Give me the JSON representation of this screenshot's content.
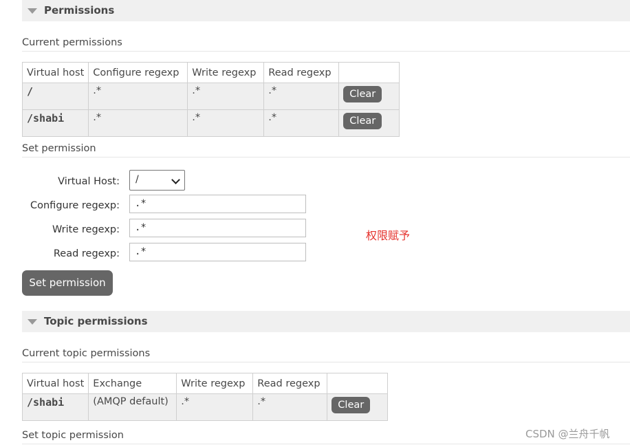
{
  "permissions_section": {
    "title": "Permissions",
    "current_title": "Current permissions",
    "table": {
      "headers": [
        "Virtual host",
        "Configure regexp",
        "Write regexp",
        "Read regexp"
      ],
      "rows": [
        {
          "vhost": "/",
          "configure": ".*",
          "write": ".*",
          "read": ".*",
          "action": "Clear"
        },
        {
          "vhost": "/shabi",
          "configure": ".*",
          "write": ".*",
          "read": ".*",
          "action": "Clear"
        }
      ]
    }
  },
  "set_permission": {
    "title": "Set permission",
    "vhost_label": "Virtual Host:",
    "vhost_value": "/",
    "configure_label": "Configure regexp:",
    "configure_value": ".*",
    "write_label": "Write regexp:",
    "write_value": ".*",
    "read_label": "Read regexp:",
    "read_value": ".*",
    "submit_label": "Set permission"
  },
  "annotation": "权限赋予",
  "topic_section": {
    "title": "Topic permissions",
    "current_title": "Current topic permissions",
    "table": {
      "headers": [
        "Virtual host",
        "Exchange",
        "Write regexp",
        "Read regexp"
      ],
      "rows": [
        {
          "vhost": "/shabi",
          "exchange": "(AMQP default)",
          "write": ".*",
          "read": ".*",
          "action": "Clear"
        }
      ]
    },
    "set_title": "Set topic permission"
  },
  "watermark": "CSDN @兰舟千帆",
  "colors": {
    "button": "#666666",
    "header_bg": "#f0f0f0",
    "annotation": "#e5322d"
  },
  "icons": {
    "section_toggle": "triangle-down-icon",
    "select_arrow": "chevron-down-icon"
  }
}
